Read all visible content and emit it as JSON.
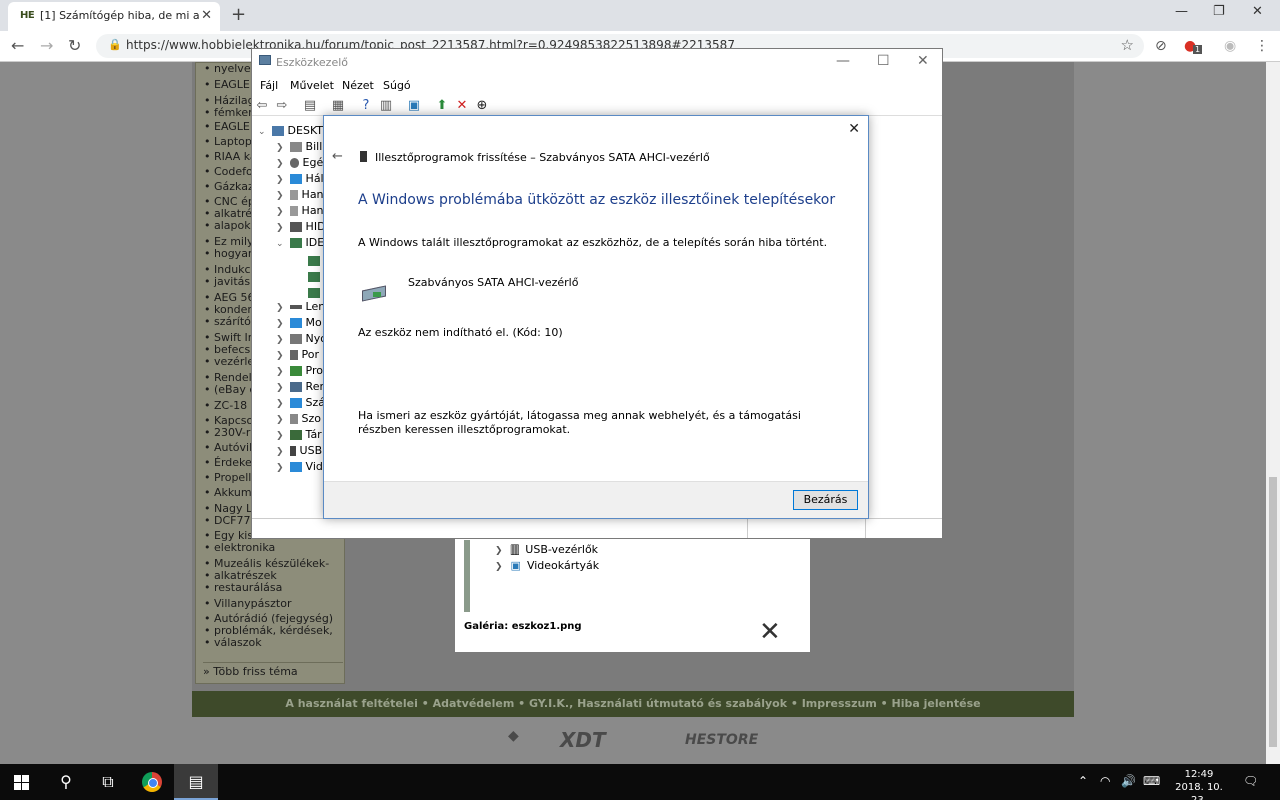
{
  "browser": {
    "tab_favicon": "HE",
    "tab_title": "[1] Számítógép hiba, de mi a pro",
    "url": "https://www.hobbielektronika.hu/forum/topic_post_2213587.html?r=0.924985382251389​8#2213587",
    "extension_badge": "1"
  },
  "sidebar": {
    "items": [
      "nyelve",
      "EAGLE",
      "Házilag",
      "fémker",
      "EAGLE",
      "Laptop",
      "RIAA ka",
      "Codefo",
      "Gázkaz",
      "CNC ép",
      "alkatré",
      "alapok",
      "Ez mily",
      "hogyan",
      "Indukc",
      "javitás",
      "AEG 56",
      "konder",
      "szárító",
      "Swift Ir",
      "befecsk",
      "vezérle",
      "Rendel",
      "(eBay c",
      "ZC-18",
      "Kapcso",
      "230V-r",
      "Autóvil",
      "Érdeke",
      "Propell",
      "Akkum",
      "Nagy L",
      "DCF77",
      "Egy kis",
      "elektronika",
      "Muzeális készülékek-",
      "alkatrészek",
      "restaurálása",
      "Villanypásztor",
      "Autórádió (fejegység)",
      "problémák, kérdések,",
      "válaszok"
    ],
    "more_link": "» Több friss téma"
  },
  "footer": {
    "links": "A használat feltételei • Adatvédelem • GY.I.K., Használati útmutató és szabályok • Impresszum • Hiba jelentése"
  },
  "logos": [
    "XDT",
    "HESTORE"
  ],
  "gallery": {
    "rows": [
      "USB-vezérlők",
      "Videokártyák"
    ],
    "caption": "Galéria: eszkoz1.png"
  },
  "device_manager": {
    "title": "Eszközkezelő",
    "menu": [
      "Fájl",
      "Művelet",
      "Nézet",
      "Súgó"
    ],
    "tree_root": "DESKTO",
    "tree_items": [
      "Bill",
      "Egé",
      "Hál",
      "Han",
      "Han",
      "HID",
      "IDE",
      "Len",
      "Mo",
      "Nyo",
      "Por",
      "Pro",
      "Ren",
      "Szá",
      "Szo",
      "Tár",
      "USB",
      "Vid"
    ]
  },
  "dialog": {
    "header": "Illesztőprogramok frissítése – Szabványos SATA AHCI-vezérlő",
    "heading": "A Windows problémába ütközött az eszköz illesztőinek telepítésekor",
    "message": "A Windows talált illesztőprogramokat az eszközhöz, de a telepítés során hiba történt.",
    "device_name": "Szabványos SATA AHCI-vezérlő",
    "error": "Az eszköz nem indítható el. (Kód: 10)",
    "hint": "Ha ismeri az eszköz gyártóját, látogassa meg annak webhelyét, és a támogatási részben keressen illesztőprogramokat.",
    "close_label": "Bezárás"
  },
  "taskbar": {
    "time": "12:49",
    "date": "2018. 10. 23."
  }
}
